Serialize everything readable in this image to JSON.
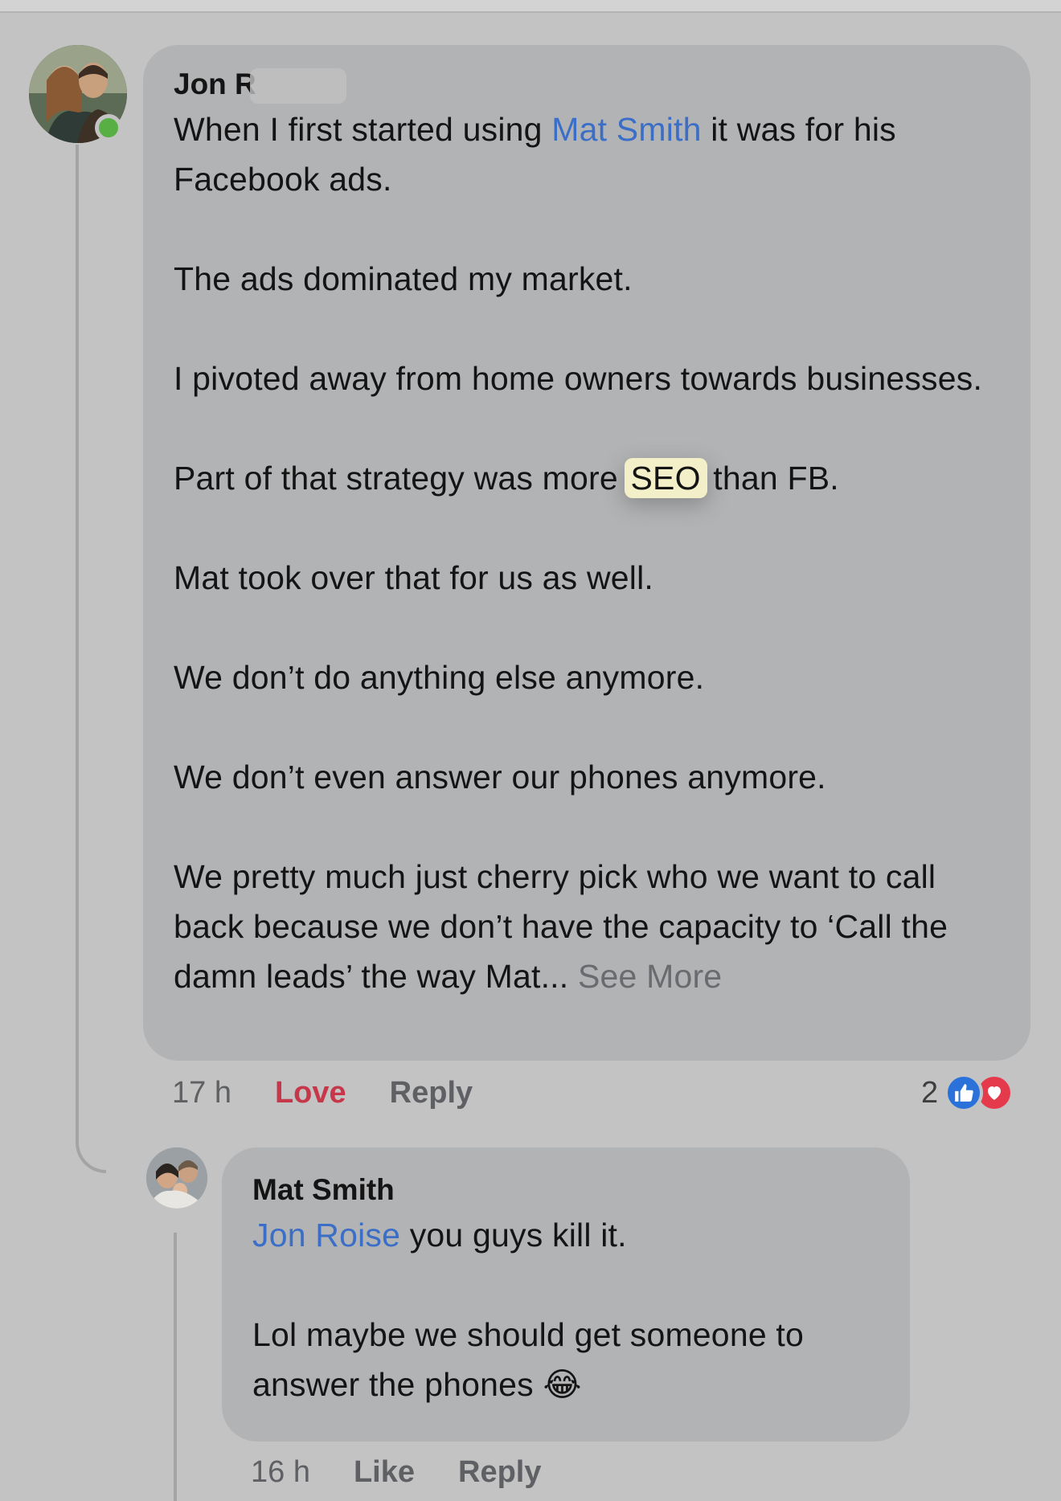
{
  "comment": {
    "author": "Jon R",
    "paragraphs": [
      {
        "segments": [
          {
            "text": "When I first started using ",
            "type": "text"
          },
          {
            "text": "Mat Smith",
            "type": "mention"
          },
          {
            "text": " it was for his Facebook ads.",
            "type": "text"
          }
        ]
      },
      {
        "segments": [
          {
            "text": "The ads dominated my market.",
            "type": "text"
          }
        ]
      },
      {
        "segments": [
          {
            "text": "I pivoted away from home owners towards businesses.",
            "type": "text"
          }
        ]
      },
      {
        "segments": [
          {
            "text": "Part of that strategy was more ",
            "type": "text"
          },
          {
            "text": "SEO",
            "type": "highlight"
          },
          {
            "text": " than FB.",
            "type": "text"
          }
        ]
      },
      {
        "segments": [
          {
            "text": "Mat took over that for us as well.",
            "type": "text"
          }
        ]
      },
      {
        "segments": [
          {
            "text": "We don’t do anything else anymore.",
            "type": "text"
          }
        ]
      },
      {
        "segments": [
          {
            "text": "We don’t even answer our phones anymore.",
            "type": "text"
          }
        ]
      },
      {
        "segments": [
          {
            "text": "We pretty much just cherry pick who we want to call back because we don’t have the capacity to ‘Call the damn leads’ the way Mat...",
            "type": "text"
          },
          {
            "text": " See More",
            "type": "see-more"
          }
        ]
      }
    ],
    "time": "17 h",
    "love_label": "Love",
    "reply_label": "Reply",
    "reaction_count": "2"
  },
  "reply": {
    "author": "Mat Smith",
    "paragraphs": [
      {
        "segments": [
          {
            "text": "Jon Roise",
            "type": "mention"
          },
          {
            "text": " you guys kill it.",
            "type": "text"
          }
        ]
      },
      {
        "segments": [
          {
            "text": "Lol maybe we should get someone to answer the phones ",
            "type": "text"
          },
          {
            "text": "😂",
            "type": "emoji"
          }
        ]
      }
    ],
    "time": "16 h",
    "like_label": "Like",
    "reply_label": "Reply"
  },
  "colors": {
    "mention": "#3b6ec6",
    "love": "#c7374a",
    "like_blue": "#2a72d9",
    "love_red": "#e5394c",
    "online": "#58b045"
  },
  "icons": [
    "like-reaction-icon",
    "love-reaction-icon",
    "laughing-emoji-icon",
    "online-status-icon"
  ]
}
